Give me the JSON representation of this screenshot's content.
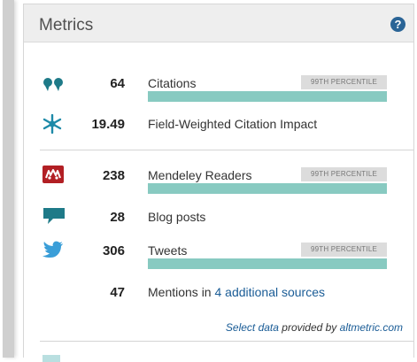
{
  "panel": {
    "title": "Metrics",
    "help_symbol": "?"
  },
  "metrics": [
    {
      "icon": "quote-icon",
      "value": "64",
      "label": "Citations",
      "badge": "99TH PERCENTILE",
      "percentile_bar": true
    },
    {
      "icon": "snowflake-icon",
      "value": "19.49",
      "label": "Field-Weighted Citation Impact"
    },
    {
      "icon": "mendeley-icon",
      "value": "238",
      "label": "Mendeley Readers",
      "badge": "99TH PERCENTILE",
      "percentile_bar": true
    },
    {
      "icon": "speech-bubble-icon",
      "value": "28",
      "label": "Blog posts"
    },
    {
      "icon": "twitter-bird-icon",
      "value": "306",
      "label": "Tweets",
      "badge": "99TH PERCENTILE",
      "percentile_bar": true
    },
    {
      "value": "47",
      "label_prefix": "Mentions in ",
      "label_link": "4 additional sources"
    }
  ],
  "footer": {
    "link1": "Select data",
    "middle": " provided by ",
    "link2": "altmetric.com"
  },
  "colors": {
    "bar": "#88cac1",
    "link": "#1a5c96",
    "mendeley": "#b21f24",
    "icon_teal": "#1e7a88",
    "twitter": "#3a9ed8"
  }
}
